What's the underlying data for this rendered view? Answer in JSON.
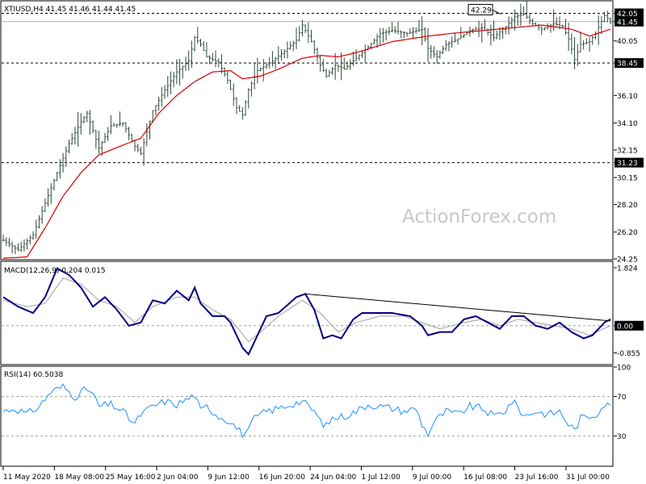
{
  "chart_data": [
    {
      "type": "ohlc",
      "title": "XTIUSD,H4  41.45 41.46 41.44 41.45",
      "ylim": [
        24.25,
        42.9
      ],
      "y_ticks": [
        42.05,
        41.45,
        40.05,
        38.45,
        36.1,
        34.1,
        32.15,
        31.23,
        30.15,
        28.2,
        26.2,
        24.25
      ],
      "y_ticks_marked": [
        "42.05",
        "41.45",
        "38.45",
        "31.23"
      ],
      "horizontal_lines": [
        42.05,
        38.45,
        31.23
      ],
      "current_price": 41.45,
      "annotation": "42.29",
      "watermark": "ActionForex.com",
      "series": [
        {
          "name": "price",
          "color": "#2e4a38",
          "anchors": [
            [
              0,
              25.6
            ],
            [
              5,
              24.9
            ],
            [
              10,
              26.0
            ],
            [
              14,
              28.3
            ],
            [
              18,
              30.5
            ],
            [
              22,
              32.6
            ],
            [
              26,
              34.2
            ],
            [
              28,
              34.8
            ],
            [
              32,
              32.3
            ],
            [
              36,
              33.9
            ],
            [
              40,
              34.1
            ],
            [
              44,
              32.4
            ],
            [
              46,
              31.9
            ],
            [
              50,
              35.0
            ],
            [
              54,
              36.5
            ],
            [
              58,
              37.8
            ],
            [
              62,
              38.6
            ],
            [
              64,
              40.3
            ],
            [
              66,
              39.8
            ],
            [
              68,
              38.9
            ],
            [
              72,
              38.5
            ],
            [
              75,
              37.2
            ],
            [
              78,
              35.2
            ],
            [
              80,
              34.7
            ],
            [
              82,
              36.5
            ],
            [
              85,
              37.9
            ],
            [
              90,
              38.6
            ],
            [
              94,
              39.3
            ],
            [
              98,
              40.1
            ],
            [
              100,
              41.2
            ],
            [
              103,
              40.0
            ],
            [
              106,
              38.3
            ],
            [
              108,
              37.5
            ],
            [
              111,
              38.3
            ],
            [
              114,
              38.0
            ],
            [
              118,
              38.8
            ],
            [
              122,
              39.6
            ],
            [
              126,
              40.6
            ],
            [
              130,
              40.8
            ],
            [
              135,
              40.6
            ],
            [
              140,
              40.9
            ],
            [
              142,
              39.5
            ],
            [
              145,
              38.9
            ],
            [
              148,
              39.8
            ],
            [
              152,
              40.2
            ],
            [
              156,
              40.8
            ],
            [
              160,
              41.0
            ],
            [
              164,
              40.3
            ],
            [
              168,
              41.1
            ],
            [
              171,
              41.8
            ],
            [
              174,
              42.0
            ],
            [
              177,
              41.3
            ],
            [
              180,
              40.9
            ],
            [
              184,
              41.3
            ],
            [
              187,
              41.1
            ],
            [
              189,
              40.2
            ],
            [
              191,
              38.7
            ],
            [
              193,
              39.8
            ],
            [
              196,
              40.0
            ],
            [
              198,
              40.6
            ],
            [
              201,
              41.9
            ],
            [
              203,
              41.45
            ]
          ]
        },
        {
          "name": "moving-average",
          "color": "#d40000",
          "anchors": [
            [
              0,
              24.3
            ],
            [
              8,
              24.4
            ],
            [
              14,
              26.5
            ],
            [
              20,
              28.8
            ],
            [
              26,
              30.5
            ],
            [
              32,
              31.8
            ],
            [
              40,
              32.5
            ],
            [
              46,
              33.0
            ],
            [
              52,
              34.8
            ],
            [
              58,
              36.1
            ],
            [
              64,
              37.1
            ],
            [
              70,
              37.8
            ],
            [
              76,
              37.9
            ],
            [
              80,
              37.3
            ],
            [
              86,
              37.5
            ],
            [
              92,
              38.0
            ],
            [
              100,
              38.8
            ],
            [
              106,
              39.0
            ],
            [
              112,
              38.9
            ],
            [
              118,
              39.2
            ],
            [
              124,
              39.6
            ],
            [
              130,
              40.0
            ],
            [
              136,
              40.2
            ],
            [
              142,
              40.4
            ],
            [
              150,
              40.6
            ],
            [
              160,
              40.8
            ],
            [
              170,
              41.0
            ],
            [
              180,
              41.2
            ],
            [
              190,
              40.9
            ],
            [
              196,
              40.4
            ],
            [
              203,
              40.9
            ]
          ]
        }
      ]
    },
    {
      "type": "line",
      "title": "MACD(12,26,9) 0.204 0.015",
      "ylim": [
        -1.2,
        2.0
      ],
      "y_ticks": [
        1.824,
        0.0,
        -0.855
      ],
      "y_ticks_marked": [
        "0.00"
      ],
      "zero_line": 0,
      "series": [
        {
          "name": "MACD",
          "color": "#000080",
          "anchors": [
            [
              0,
              0.9
            ],
            [
              5,
              0.6
            ],
            [
              10,
              0.4
            ],
            [
              14,
              0.9
            ],
            [
              18,
              1.8
            ],
            [
              22,
              1.6
            ],
            [
              26,
              1.2
            ],
            [
              30,
              0.6
            ],
            [
              34,
              0.9
            ],
            [
              38,
              0.5
            ],
            [
              42,
              0.0
            ],
            [
              46,
              0.1
            ],
            [
              50,
              0.8
            ],
            [
              54,
              0.7
            ],
            [
              58,
              1.1
            ],
            [
              62,
              0.8
            ],
            [
              64,
              1.2
            ],
            [
              66,
              0.7
            ],
            [
              70,
              0.3
            ],
            [
              74,
              0.3
            ],
            [
              76,
              0.1
            ],
            [
              80,
              -0.7
            ],
            [
              82,
              -0.9
            ],
            [
              85,
              -0.3
            ],
            [
              88,
              0.3
            ],
            [
              92,
              0.4
            ],
            [
              98,
              0.9
            ],
            [
              101,
              1.0
            ],
            [
              104,
              0.5
            ],
            [
              107,
              -0.4
            ],
            [
              110,
              -0.3
            ],
            [
              113,
              -0.4
            ],
            [
              117,
              0.2
            ],
            [
              120,
              0.4
            ],
            [
              126,
              0.4
            ],
            [
              130,
              0.4
            ],
            [
              136,
              0.3
            ],
            [
              140,
              0.0
            ],
            [
              142,
              -0.3
            ],
            [
              146,
              -0.2
            ],
            [
              150,
              -0.2
            ],
            [
              154,
              0.2
            ],
            [
              158,
              0.3
            ],
            [
              162,
              0.1
            ],
            [
              166,
              -0.1
            ],
            [
              170,
              0.3
            ],
            [
              174,
              0.3
            ],
            [
              178,
              0.0
            ],
            [
              182,
              -0.1
            ],
            [
              186,
              0.1
            ],
            [
              190,
              -0.2
            ],
            [
              194,
              -0.4
            ],
            [
              197,
              -0.3
            ],
            [
              201,
              0.1
            ],
            [
              203,
              0.2
            ]
          ]
        },
        {
          "name": "signal",
          "color": "#a0a0a0",
          "anchors": [
            [
              0,
              0.8
            ],
            [
              8,
              0.6
            ],
            [
              14,
              0.7
            ],
            [
              20,
              1.5
            ],
            [
              26,
              1.3
            ],
            [
              32,
              0.8
            ],
            [
              38,
              0.6
            ],
            [
              44,
              0.1
            ],
            [
              50,
              0.6
            ],
            [
              58,
              0.9
            ],
            [
              64,
              0.9
            ],
            [
              70,
              0.5
            ],
            [
              76,
              0.2
            ],
            [
              82,
              -0.5
            ],
            [
              86,
              -0.2
            ],
            [
              92,
              0.3
            ],
            [
              100,
              0.8
            ],
            [
              106,
              0.4
            ],
            [
              112,
              -0.2
            ],
            [
              118,
              0.1
            ],
            [
              126,
              0.3
            ],
            [
              134,
              0.3
            ],
            [
              140,
              0.1
            ],
            [
              146,
              -0.1
            ],
            [
              154,
              0.1
            ],
            [
              160,
              0.2
            ],
            [
              166,
              0.0
            ],
            [
              172,
              0.2
            ],
            [
              178,
              0.1
            ],
            [
              184,
              0.0
            ],
            [
              190,
              -0.1
            ],
            [
              196,
              -0.3
            ],
            [
              203,
              0.0
            ]
          ]
        }
      ],
      "trendline": [
        [
          101,
          1.0
        ],
        [
          203,
          0.15
        ]
      ]
    },
    {
      "type": "line",
      "title": "RSI(14) 60.5038",
      "ylim": [
        0,
        100
      ],
      "y_ticks": [
        100,
        70,
        30,
        0
      ],
      "levels": [
        70,
        30
      ],
      "series": [
        {
          "name": "RSI",
          "color": "#1e90ff",
          "anchors": [
            [
              0,
              55
            ],
            [
              4,
              58
            ],
            [
              8,
              52
            ],
            [
              12,
              60
            ],
            [
              16,
              75
            ],
            [
              20,
              80
            ],
            [
              24,
              70
            ],
            [
              28,
              78
            ],
            [
              30,
              72
            ],
            [
              32,
              60
            ],
            [
              36,
              62
            ],
            [
              40,
              55
            ],
            [
              42,
              48
            ],
            [
              44,
              42
            ],
            [
              46,
              52
            ],
            [
              50,
              60
            ],
            [
              54,
              65
            ],
            [
              58,
              62
            ],
            [
              62,
              68
            ],
            [
              64,
              72
            ],
            [
              66,
              55
            ],
            [
              68,
              60
            ],
            [
              72,
              50
            ],
            [
              76,
              45
            ],
            [
              78,
              38
            ],
            [
              80,
              32
            ],
            [
              82,
              35
            ],
            [
              84,
              48
            ],
            [
              88,
              55
            ],
            [
              92,
              58
            ],
            [
              96,
              62
            ],
            [
              100,
              65
            ],
            [
              104,
              55
            ],
            [
              106,
              45
            ],
            [
              108,
              40
            ],
            [
              110,
              48
            ],
            [
              114,
              50
            ],
            [
              118,
              55
            ],
            [
              122,
              62
            ],
            [
              126,
              60
            ],
            [
              130,
              58
            ],
            [
              134,
              55
            ],
            [
              138,
              58
            ],
            [
              140,
              42
            ],
            [
              142,
              32
            ],
            [
              144,
              44
            ],
            [
              148,
              55
            ],
            [
              152,
              52
            ],
            [
              156,
              60
            ],
            [
              160,
              58
            ],
            [
              164,
              50
            ],
            [
              168,
              56
            ],
            [
              170,
              65
            ],
            [
              172,
              60
            ],
            [
              174,
              50
            ],
            [
              178,
              55
            ],
            [
              182,
              52
            ],
            [
              186,
              55
            ],
            [
              189,
              42
            ],
            [
              191,
              36
            ],
            [
              193,
              48
            ],
            [
              196,
              50
            ],
            [
              198,
              52
            ],
            [
              201,
              62
            ],
            [
              203,
              60
            ]
          ]
        }
      ]
    }
  ],
  "x_axis": {
    "labels": [
      "11 May 2020",
      "18 May 08:00",
      "25 May 16:00",
      "2 Jun 04:00",
      "9 Jun 12:00",
      "16 Jun 20:00",
      "24 Jun 04:00",
      "1 Jul 12:00",
      "9 Jul 00:00",
      "16 Jul 08:00",
      "23 Jul 16:00",
      "31 Jul 00:00"
    ],
    "label_bar_index": [
      0,
      22,
      44,
      66,
      88,
      110,
      132,
      154,
      176,
      198,
      220,
      242
    ],
    "n_bars": 204
  }
}
